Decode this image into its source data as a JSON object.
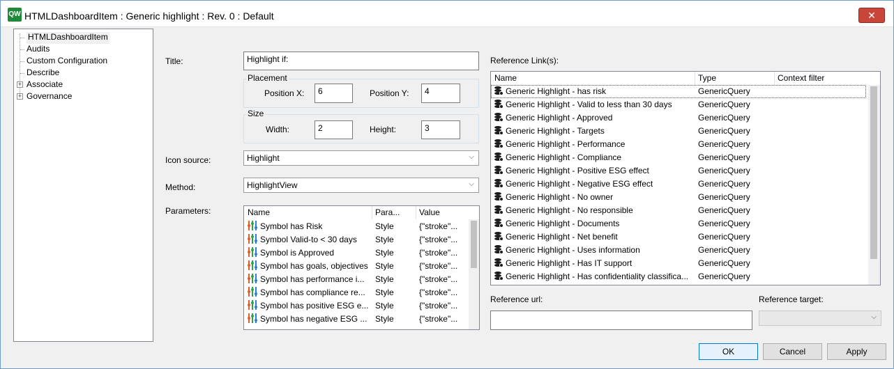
{
  "window": {
    "app_icon": "QW",
    "title": "HTMLDashboardItem : Generic highlight : Rev. 0  : Default",
    "close_icon": "✕"
  },
  "tree": {
    "items": [
      {
        "label": "HTMLDashboardItem",
        "expandable": false
      },
      {
        "label": "Audits",
        "expandable": false
      },
      {
        "label": "Custom Configuration",
        "expandable": false
      },
      {
        "label": "Describe",
        "expandable": false
      },
      {
        "label": "Associate",
        "expandable": true
      },
      {
        "label": "Governance",
        "expandable": true
      }
    ],
    "expander_symbol": "+"
  },
  "form": {
    "title_label": "Title:",
    "title_value": "Highlight if:",
    "placement_label": "Placement",
    "position_x_label": "Position X:",
    "position_x_value": "6",
    "position_y_label": "Position Y:",
    "position_y_value": "4",
    "size_label": "Size",
    "width_label": "Width:",
    "width_value": "2",
    "height_label": "Height:",
    "height_value": "3",
    "icon_source_label": "Icon source:",
    "icon_source_value": "Highlight",
    "method_label": "Method:",
    "method_value": "HighlightView",
    "parameters_label": "Parameters:"
  },
  "parameters": {
    "columns": [
      "Name",
      "Para...",
      "Value"
    ],
    "rows": [
      {
        "name": "Symbol has Risk",
        "type": "Style",
        "value": "{\"stroke\"..."
      },
      {
        "name": "Symbol Valid-to < 30 days",
        "type": "Style",
        "value": "{\"stroke\"..."
      },
      {
        "name": "Symbol is Approved",
        "type": "Style",
        "value": "{\"stroke\"..."
      },
      {
        "name": "Symbol has goals, objectives",
        "type": "Style",
        "value": "{\"stroke\"..."
      },
      {
        "name": "Symbol has performance i...",
        "type": "Style",
        "value": "{\"stroke\"..."
      },
      {
        "name": "Symbol has compliance re...",
        "type": "Style",
        "value": "{\"stroke\"..."
      },
      {
        "name": "Symbol has positive ESG e...",
        "type": "Style",
        "value": "{\"stroke\"..."
      },
      {
        "name": "Symbol has negative ESG ...",
        "type": "Style",
        "value": "{\"stroke\"..."
      }
    ]
  },
  "references": {
    "label": "Reference Link(s):",
    "columns": [
      "Name",
      "Type",
      "Context filter"
    ],
    "rows": [
      {
        "name": "Generic Highlight - has risk",
        "type": "GenericQuery",
        "filter": ""
      },
      {
        "name": "Generic Highlight - Valid to less than 30 days",
        "type": "GenericQuery",
        "filter": ""
      },
      {
        "name": "Generic Highlight - Approved",
        "type": "GenericQuery",
        "filter": ""
      },
      {
        "name": "Generic Highlight - Targets",
        "type": "GenericQuery",
        "filter": ""
      },
      {
        "name": "Generic Highlight - Performance",
        "type": "GenericQuery",
        "filter": ""
      },
      {
        "name": "Generic Highlight - Compliance",
        "type": "GenericQuery",
        "filter": ""
      },
      {
        "name": "Generic Highlight - Positive ESG effect",
        "type": "GenericQuery",
        "filter": ""
      },
      {
        "name": "Generic Highlight - Negative ESG effect",
        "type": "GenericQuery",
        "filter": ""
      },
      {
        "name": "Generic Highlight - No owner",
        "type": "GenericQuery",
        "filter": ""
      },
      {
        "name": "Generic Highlight - No responsible",
        "type": "GenericQuery",
        "filter": ""
      },
      {
        "name": "Generic Highlight - Documents",
        "type": "GenericQuery",
        "filter": ""
      },
      {
        "name": "Generic Highlight - Net benefit",
        "type": "GenericQuery",
        "filter": ""
      },
      {
        "name": "Generic Highlight - Uses information",
        "type": "GenericQuery",
        "filter": ""
      },
      {
        "name": "Generic Highlight - Has IT support",
        "type": "GenericQuery",
        "filter": ""
      },
      {
        "name": "Generic Highlight - Has confidentiality classifica...",
        "type": "GenericQuery",
        "filter": ""
      }
    ],
    "url_label": "Reference url:",
    "url_value": "",
    "target_label": "Reference target:",
    "target_value": ""
  },
  "buttons": {
    "ok": "OK",
    "cancel": "Cancel",
    "apply": "Apply"
  },
  "combo_chevron": "⌵",
  "colors": {
    "app_icon_bg": "#1f8a3a",
    "close_button": "#c9453a",
    "ok_border": "#0078d7"
  }
}
